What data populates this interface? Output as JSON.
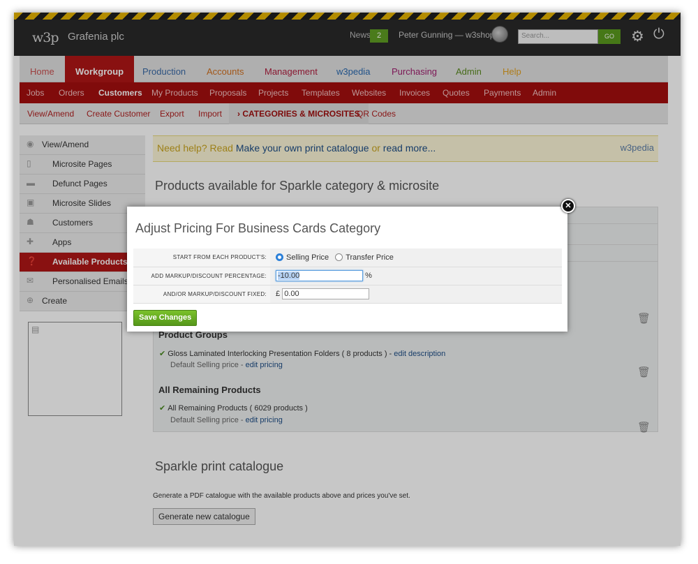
{
  "topbar": {
    "logo": "w3p",
    "company": "Grafenia plc",
    "news_label": "News",
    "news_count": "2",
    "user": "Peter Gunning — w3shop",
    "search_placeholder": "Search...",
    "go_label": "GO"
  },
  "nav1": [
    "Home",
    "Workgroup",
    "Production",
    "Accounts",
    "Management",
    "w3pedia",
    "Purchasing",
    "Admin",
    "Help"
  ],
  "nav2": [
    "Jobs",
    "Orders",
    "Customers",
    "My Products",
    "Proposals",
    "Projects",
    "Templates",
    "Websites",
    "Invoices",
    "Quotes",
    "Payments",
    "Admin"
  ],
  "nav3": [
    "View/Amend",
    "Create Customer",
    "Export",
    "Import",
    "› CATEGORIES & MICROSITES",
    "QR Codes"
  ],
  "sidebar": [
    "View/Amend",
    "Microsite Pages",
    "Defunct Pages",
    "Microsite Slides",
    "Customers",
    "Apps",
    "Available Products",
    "Personalised Emails",
    "Create"
  ],
  "help": {
    "prefix": "Need help? Read",
    "link1": "Make your own print catalogue",
    "or": "or",
    "link2": "read more...",
    "badge": "w3pedia"
  },
  "main": {
    "title": "Products available for Sparkle category & microsite",
    "groups_heading": "Product Groups",
    "group_item": "Gloss Laminated Interlocking Presentation Folders ( 8 products ) -",
    "edit_description": "edit description",
    "default_price": "Default Selling price -",
    "edit_pricing": "edit pricing",
    "remaining_heading": "All Remaining Products",
    "remaining_item": "All Remaining Products ( 6029 products )",
    "catalogue_title": "Sparkle print catalogue",
    "catalogue_desc": "Generate a PDF catalogue with the available products above and prices you've set.",
    "catalogue_button": "Generate new catalogue"
  },
  "modal": {
    "title": "Adjust Pricing For Business Cards Category",
    "row1_label": "START FROM EACH PRODUCT'S:",
    "opt1": "Selling Price",
    "opt2": "Transfer Price",
    "row2_label": "ADD MARKUP/DISCOUNT PERCENTAGE:",
    "percent_value": "-10.00",
    "percent_sign": "%",
    "row3_label": "AND/OR MARKUP/DISCOUNT FIXED:",
    "currency": "£",
    "fixed_value": "0.00",
    "save": "Save Changes"
  }
}
